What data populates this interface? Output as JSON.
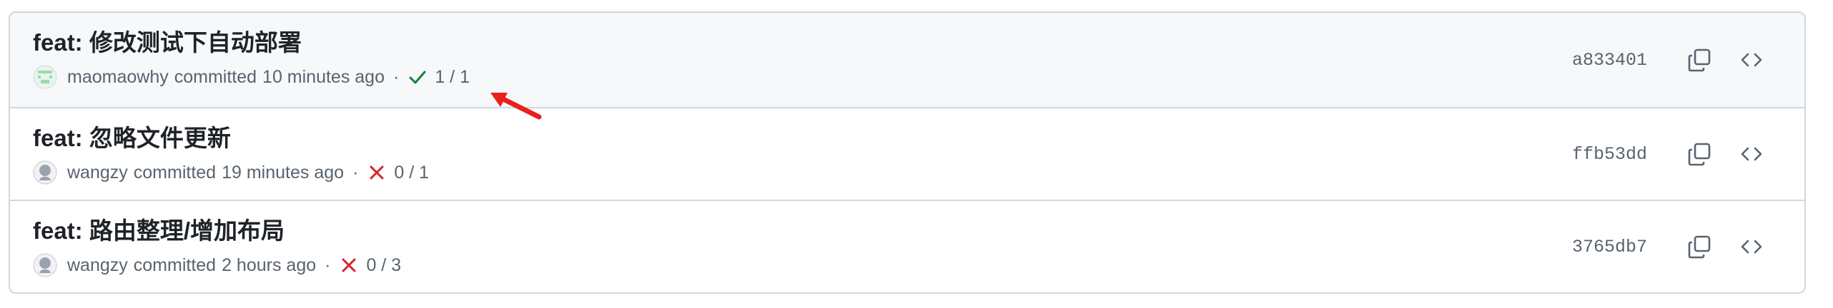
{
  "commits": [
    {
      "title": "feat: 修改测试下自动部署",
      "author": "maomaowhy",
      "committed_text": "committed",
      "time": "10 minutes ago",
      "status": "success",
      "checks": "1 / 1",
      "sha": "a833401",
      "avatar_icon": "identicon-green"
    },
    {
      "title": "feat: 忽略文件更新",
      "author": "wangzy",
      "committed_text": "committed",
      "time": "19 minutes ago",
      "status": "failure",
      "checks": "0 / 1",
      "sha": "ffb53dd",
      "avatar_icon": "github-default-avatar"
    },
    {
      "title": "feat: 路由整理/增加布局",
      "author": "wangzy",
      "committed_text": "committed",
      "time": "2 hours ago",
      "status": "failure",
      "checks": "0 / 3",
      "sha": "3765db7",
      "avatar_icon": "github-default-avatar"
    }
  ],
  "separator": "·",
  "colors": {
    "success": "#1a7f37",
    "failure": "#d1242f",
    "border": "#d0d7de",
    "muted": "#59636e",
    "highlight_bg": "#f6f8fa",
    "annotation_arrow": "#e8211b"
  },
  "icons": {
    "copy": "copy-icon",
    "browse": "code-icon",
    "success": "check-icon",
    "failure": "x-icon",
    "annotation": "red-arrow-annotation"
  }
}
